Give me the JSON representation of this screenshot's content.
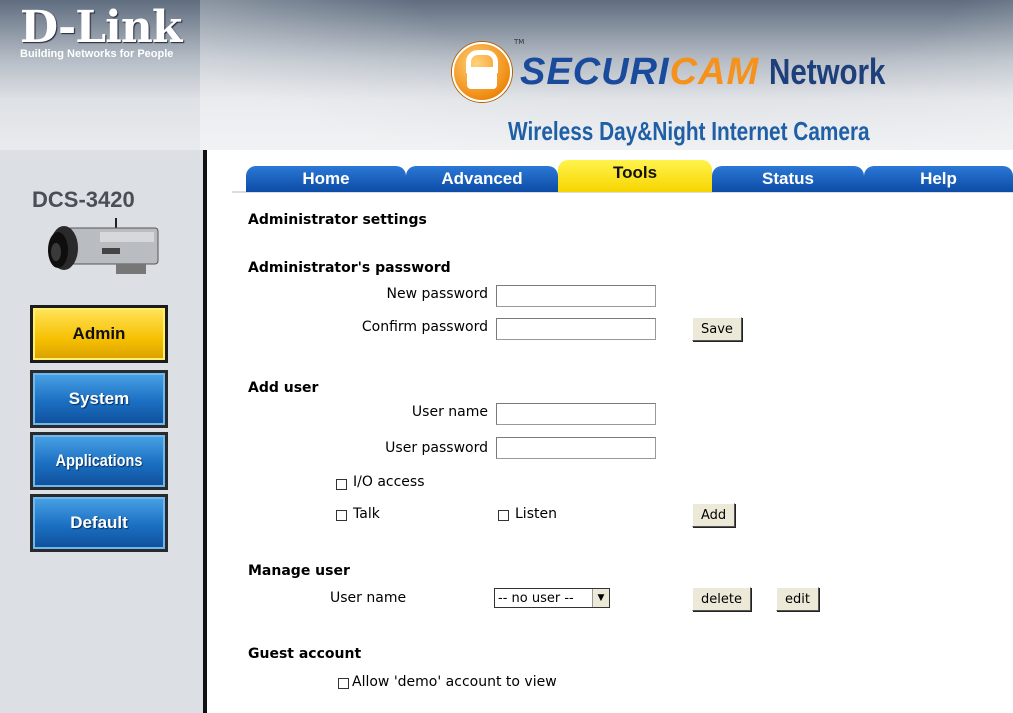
{
  "header": {
    "logo": "D-Link",
    "logo_tagline": "Building Networks for People",
    "brand_securi": "SECURI",
    "brand_cam": "CAM",
    "brand_network": "Network",
    "trademark": "TM",
    "subtitle": "Wireless Day&Night Internet Camera"
  },
  "sidebar": {
    "model": "DCS-3420",
    "items": [
      {
        "label": "Admin",
        "active": true
      },
      {
        "label": "System",
        "active": false
      },
      {
        "label": "Applications",
        "active": false
      },
      {
        "label": "Default",
        "active": false
      }
    ]
  },
  "tabs": [
    {
      "label": "Home",
      "active": false
    },
    {
      "label": "Advanced",
      "active": false
    },
    {
      "label": "Tools",
      "active": true
    },
    {
      "label": "Status",
      "active": false
    },
    {
      "label": "Help",
      "active": false
    }
  ],
  "page": {
    "title": "Administrator settings",
    "admin_password": {
      "heading": "Administrator's password",
      "new_password_label": "New password",
      "new_password_value": "",
      "confirm_password_label": "Confirm password",
      "confirm_password_value": "",
      "save_label": "Save"
    },
    "add_user": {
      "heading": "Add user",
      "user_name_label": "User name",
      "user_name_value": "",
      "user_password_label": "User password",
      "user_password_value": "",
      "io_access_label": "I/O access",
      "talk_label": "Talk",
      "listen_label": "Listen",
      "add_label": "Add"
    },
    "manage_user": {
      "heading": "Manage user",
      "user_name_label": "User name",
      "selected_user": "-- no user --",
      "delete_label": "delete",
      "edit_label": "edit"
    },
    "guest": {
      "heading": "Guest account",
      "allow_demo_label": "Allow 'demo' account to view"
    }
  },
  "colors": {
    "tab_blue": "#1560c0",
    "active_yellow": "#f7d500",
    "brand_blue": "#1a4a9c",
    "brand_orange": "#f5921e"
  }
}
